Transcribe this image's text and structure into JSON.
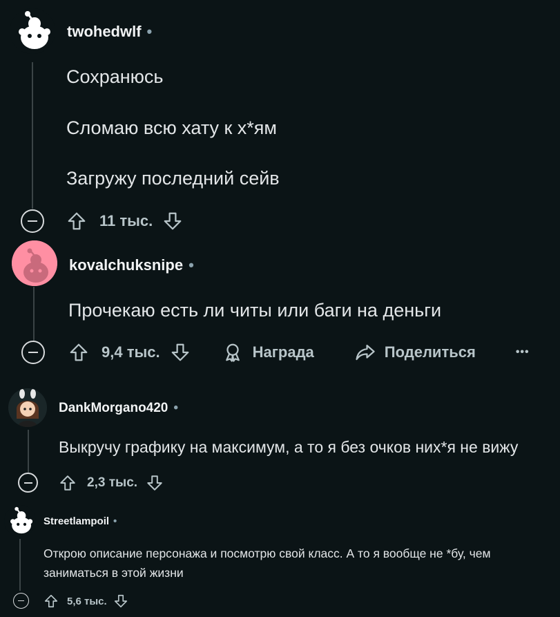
{
  "comments": [
    {
      "username": "twohedwlf",
      "lines": [
        "Сохранюсь",
        "Сломаю всю хату к х*ям",
        "Загружу последний сейв"
      ],
      "votes": "11 тыс."
    },
    {
      "username": "kovalchuksnipe",
      "lines": [
        "Прочекаю есть ли читы или баги на деньги"
      ],
      "votes": "9,4 тыс.",
      "award_label": "Награда",
      "share_label": "Поделиться",
      "more_label": "•••"
    },
    {
      "username": "DankMorgano420",
      "lines": [
        "Выкручу графику на максимум, а то я без очков них*я не вижу"
      ],
      "votes": "2,3 тыс."
    },
    {
      "username": "Streetlampoil",
      "lines": [
        "Открою описание персонажа и посмотрю свой класс. А то я вообще не *бу, чем",
        "заниматься в этой жизни"
      ],
      "votes": "5,6 тыс."
    }
  ],
  "separator": "•",
  "colors": {
    "background": "#0b1416",
    "text": "#d7dadc",
    "muted": "#8ba2ad",
    "avatar_pink": "#ff8fa3"
  }
}
